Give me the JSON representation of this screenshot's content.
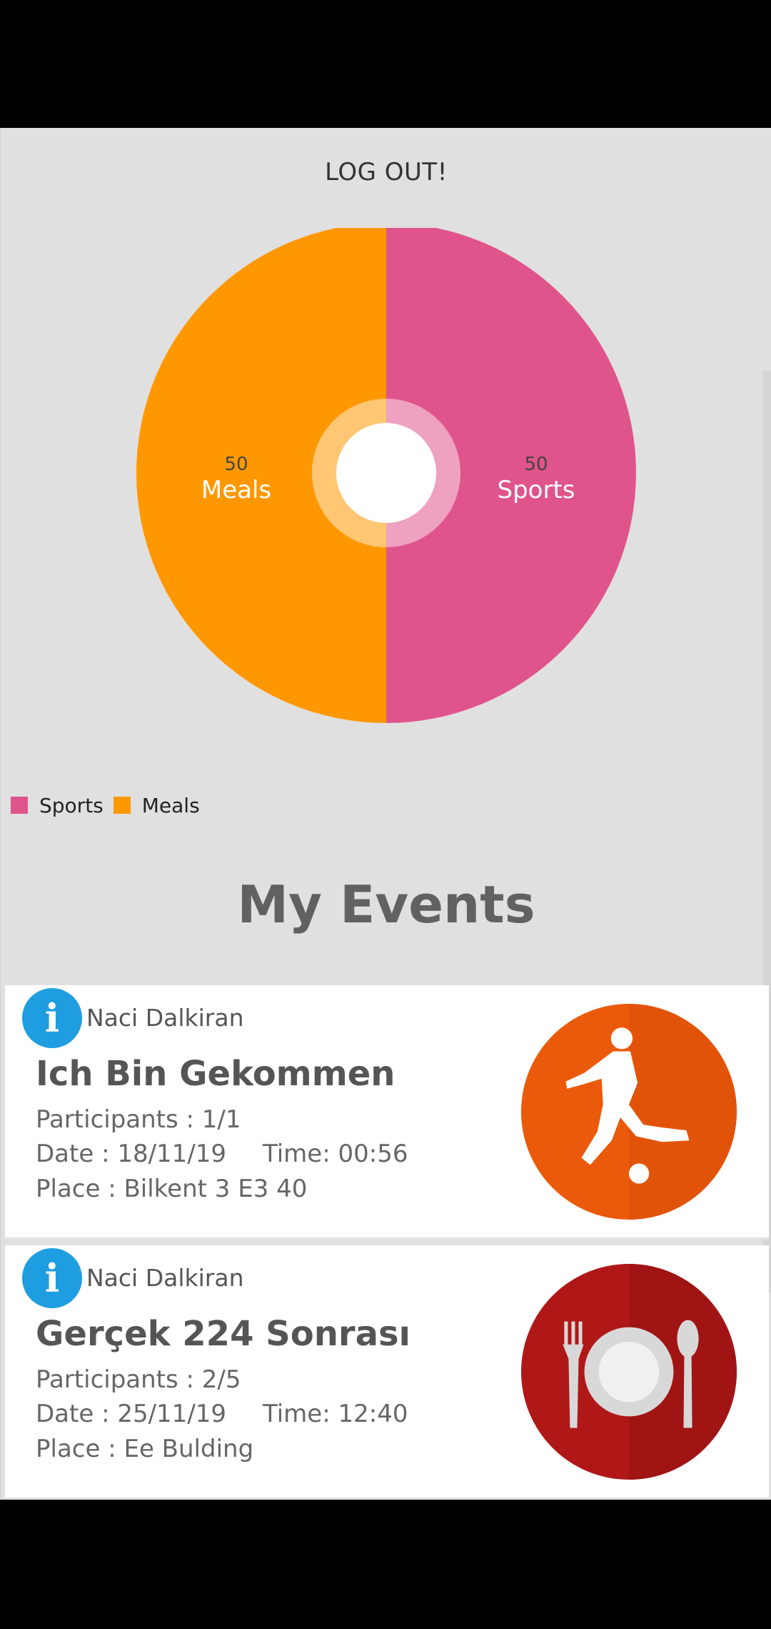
{
  "header": {
    "logout_label": "LOG OUT!"
  },
  "chart_data": {
    "type": "pie",
    "title": "",
    "slices": [
      {
        "label": "Sports",
        "value": 50,
        "color": "#e0548c"
      },
      {
        "label": "Meals",
        "value": 50,
        "color": "#ff9800"
      }
    ],
    "legend": [
      "Sports",
      "Meals"
    ],
    "legend_position": "bottom-left",
    "donut_hole": true
  },
  "events_section": {
    "title": "My Events"
  },
  "events": [
    {
      "organizer": "Naci Dalkiran",
      "title": "Ich Bin Gekommen",
      "participants": "Participants : 1/1",
      "date": "Date : 18/11/19",
      "time": "Time: 00:56",
      "place": "Place : Bilkent 3 E3 40",
      "image_icon": "soccer-player-icon",
      "image_color": "#eb5a0a"
    },
    {
      "organizer": "Naci Dalkiran",
      "title": "Gerçek 224 Sonrası",
      "participants": "Participants : 2/5",
      "date": "Date : 25/11/19",
      "time": "Time: 12:40",
      "place": "Place : Ee Bulding",
      "image_icon": "plate-fork-spoon-icon",
      "image_color": "#b01818"
    }
  ],
  "icons": {
    "info": "info-icon"
  },
  "colors": {
    "info_icon": "#1e9ee0",
    "background": "#e0e0e0"
  }
}
